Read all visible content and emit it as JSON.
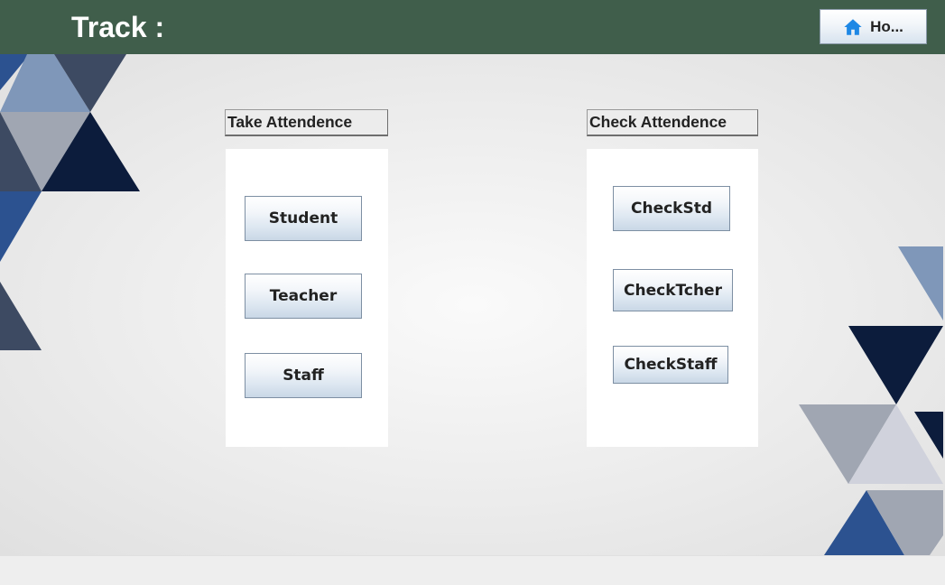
{
  "header": {
    "title": "Track :",
    "home_button": {
      "label": "Ho...",
      "icon": "home-icon"
    }
  },
  "take_attendance": {
    "heading": "Take Attendence",
    "buttons": [
      "Student",
      "Teacher",
      "Staff"
    ]
  },
  "check_attendance": {
    "heading": "Check Attendence",
    "buttons": [
      "CheckStd",
      "CheckTcher",
      "CheckStaff"
    ]
  },
  "colors": {
    "header_bg": "#405e4b",
    "header_text": "#ffffff",
    "home_icon": "#1e88e5",
    "navy": "#0c1c3c",
    "slate": "#3d4a62",
    "blue": "#2c5290",
    "steel": "#7f97b9",
    "gray": "#a0a6b2",
    "light": "#d0d2dc"
  }
}
